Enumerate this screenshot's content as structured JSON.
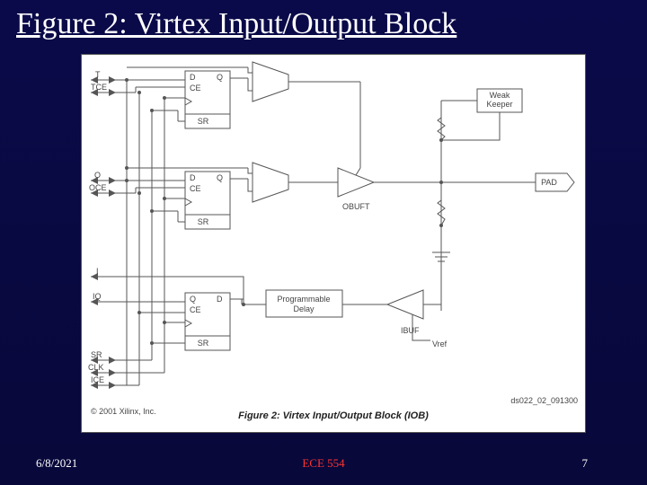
{
  "title": "Figure 2: Virtex Input/Output Block",
  "footer": {
    "date": "6/8/2021",
    "course": "ECE 554",
    "page": "7"
  },
  "diagram": {
    "caption": "Figure 2: Virtex Input/Output Block (IOB)",
    "copyright": "© 2001 Xilinx, Inc.",
    "docref": "ds022_02_091300",
    "pins": {
      "t": "T",
      "tce": "TCE",
      "o": "O",
      "oce": "OCE",
      "i": "I",
      "iq": "IQ",
      "sr": "SR",
      "clk": "CLK",
      "ice": "ICE"
    },
    "ff": {
      "d": "D",
      "q": "Q",
      "ce": "CE",
      "sr": "SR"
    },
    "blocks": {
      "pdelay": "Programmable Delay",
      "obuft": "OBUFT",
      "ibuf": "IBUF",
      "pad": "PAD",
      "weak": "Weak Keeper",
      "vref": "Vref"
    }
  }
}
